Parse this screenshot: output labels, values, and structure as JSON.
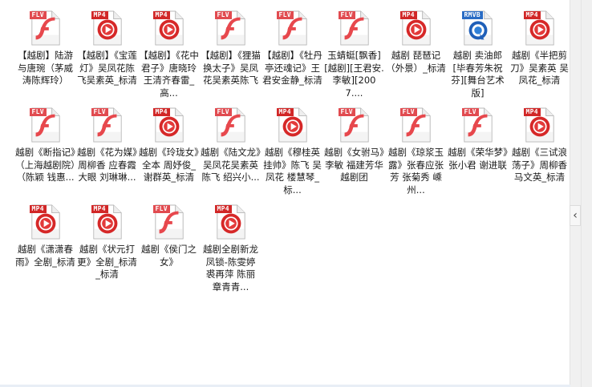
{
  "files": [
    {
      "type": "FLV",
      "label": "【越剧】陆游与唐琬（茅威涛陈辉玲）"
    },
    {
      "type": "MP4",
      "label": "【越剧】《宝莲灯》吴凤花陈飞吴素英_标清"
    },
    {
      "type": "MP4",
      "label": "【越剧】《花中君子》唐晓玲王清齐春雷_高..."
    },
    {
      "type": "FLV",
      "label": "【越剧】《狸猫换太子》吴凤花吴素英陈飞"
    },
    {
      "type": "FLV",
      "label": "【越剧】《牡丹亭还魂记》王君安金静_标清"
    },
    {
      "type": "FLV",
      "label": "玉蜻蜓[飘香][越剧][王君安.李敏][2007...."
    },
    {
      "type": "MP4",
      "label": "越剧 琵琶记（外景）_标清"
    },
    {
      "type": "RMVB",
      "label": "越剧 卖油郎 [毕春芳朱祝芬][舞台艺术版]"
    },
    {
      "type": "MP4",
      "label": "越剧《半把剪刀》吴素英 吴凤花_标清"
    },
    {
      "type": "FLV",
      "label": "越剧《断指记》（上海越剧院）（陈颖 钱惠..."
    },
    {
      "type": "FLV",
      "label": "越剧《花为媒》周柳香 应春霞 大眼 刘琳琳..."
    },
    {
      "type": "MP4",
      "label": "越剧《玲珑女》全本 周妤俊_谢群英_标清"
    },
    {
      "type": "FLV",
      "label": "越剧《陆文龙》吴凤花吴素英 陈飞 绍兴小..."
    },
    {
      "type": "MP4",
      "label": "越剧《穆桂英挂帅》陈飞 吴凤花 楼慧琴_标..."
    },
    {
      "type": "FLV",
      "label": "越剧《女驸马》李敏 福建芳华越剧团"
    },
    {
      "type": "FLV",
      "label": "越剧《琼浆玉露》张春应张芳 张菊秀 嵊州..."
    },
    {
      "type": "FLV",
      "label": "越剧《荣华梦》张小君 谢进联"
    },
    {
      "type": "MP4",
      "label": "越剧《三试浪荡子》周柳香 马文英_标清"
    },
    {
      "type": "MP4",
      "label": "越剧《潇潇春雨》全剧_标清"
    },
    {
      "type": "MP4",
      "label": "越剧《状元打更》全剧_标清_标清"
    },
    {
      "type": "FLV",
      "label": "越剧《侯门之女》"
    },
    {
      "type": "MP4",
      "label": "越剧全剧新龙凤锁-陈雯婷 裘再萍 陈丽 章青青..."
    }
  ],
  "colors": {
    "FLV": "#e14b50",
    "MP4": "#d12727",
    "RMVB": "#2a6cc4"
  },
  "sidebar": {
    "collapse_icon": "‹"
  }
}
